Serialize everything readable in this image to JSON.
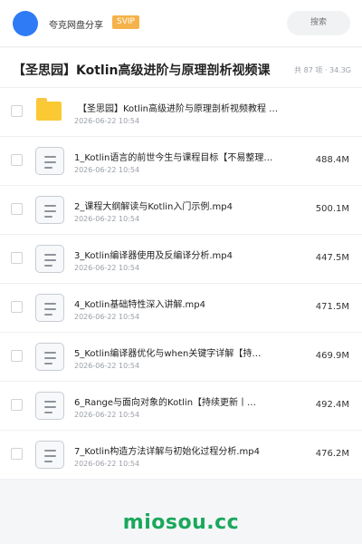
{
  "header": {
    "brand": "夸克网盘分享",
    "badge": "SVIP",
    "search_placeholder": "搜索"
  },
  "share": {
    "title": "【圣思园】Kotlin高级进阶与原理剖析视频课",
    "meta": "共 87 项 · 34.3G"
  },
  "files": [
    {
      "type": "folder",
      "name": "【圣思园】Kotlin高级进阶与原理剖析视频教程 …",
      "date": "2026-06-22 10:54",
      "size": ""
    },
    {
      "type": "file",
      "name": "1_Kotlin语言的前世今生与课程目标【不易整理…",
      "date": "2026-06-22 10:54",
      "size": "488.4M"
    },
    {
      "type": "file",
      "name": "2_课程大纲解读与Kotlin入门示例.mp4",
      "date": "2026-06-22 10:54",
      "size": "500.1M"
    },
    {
      "type": "file",
      "name": "3_Kotlin编译器使用及反编译分析.mp4",
      "date": "2026-06-22 10:54",
      "size": "447.5M"
    },
    {
      "type": "file",
      "name": "4_Kotlin基础特性深入讲解.mp4",
      "date": "2026-06-22 10:54",
      "size": "471.5M"
    },
    {
      "type": "file",
      "name": "5_Kotlin编译器优化与when关键字详解【持…",
      "date": "2026-06-22 10:54",
      "size": "469.9M"
    },
    {
      "type": "file",
      "name": "6_Range与面向对象的Kotlin【持续更新丨…",
      "date": "2026-06-22 10:54",
      "size": "492.4M"
    },
    {
      "type": "file",
      "name": "7_Kotlin构造方法详解与初始化过程分析.mp4",
      "date": "2026-06-22 10:54",
      "size": "476.2M"
    }
  ],
  "watermark": "miosou.cc",
  "colors": {
    "accent": "#2f7bf5",
    "svip": "#f6b24a",
    "folder": "#fbc934",
    "watermark": "#1aa85c"
  }
}
